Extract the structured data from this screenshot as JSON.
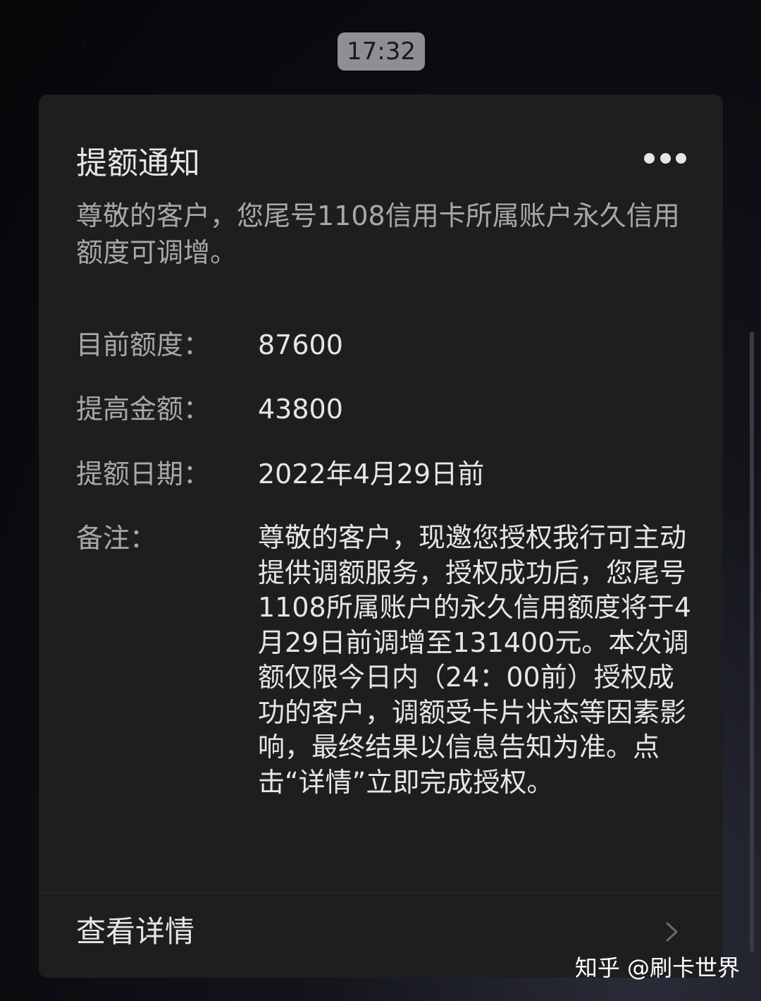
{
  "time": "17:32",
  "card": {
    "title": "提额通知",
    "more_icon": "more-icon",
    "intro": "尊敬的客户，您尾号1108信用卡所属账户永久信用额度可调增。",
    "rows": [
      {
        "label": "目前额度：",
        "value": "87600"
      },
      {
        "label": "提高金额：",
        "value": "43800"
      },
      {
        "label": "提额日期：",
        "value": "2022年4月29日前"
      }
    ],
    "note_label": "备注：",
    "note_value": "尊敬的客户，现邀您授权我行可主动提供调额服务，授权成功后，您尾号1108所属账户的永久信用额度将于4月29日前调增至131400元。本次调额仅限今日内（24：00前）授权成功的客户，调额受卡片状态等因素影响，最终结果以信息告知为准。点击“详情”立即完成授权。",
    "details_label": "查看详情",
    "chevron_icon": "chevron-right-icon"
  },
  "watermark": "知乎 @刷卡世界"
}
